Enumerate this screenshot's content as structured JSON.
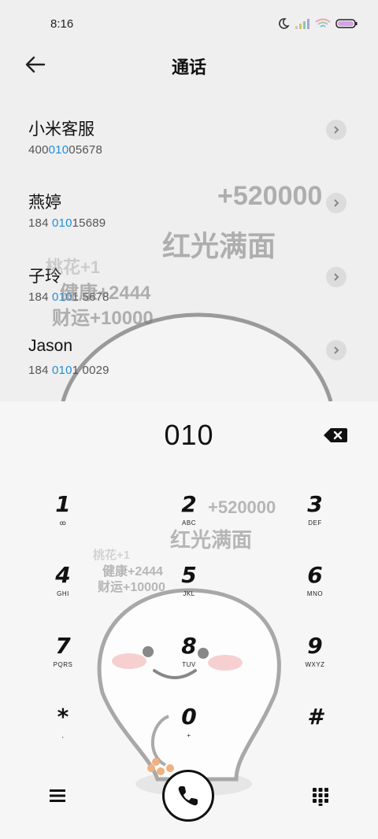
{
  "status": {
    "time": "8:16"
  },
  "header": {
    "title": "通话"
  },
  "contacts": [
    {
      "name": "小米客服",
      "num_pre": "400",
      "num_hl": "010",
      "num_post": "05678"
    },
    {
      "name": "燕婷",
      "num_pre": "184 ",
      "num_hl": "010",
      "num_post": "15689"
    },
    {
      "name": "子玲",
      "num_pre": "184 ",
      "num_hl": "010",
      "num_post": "1 5678"
    },
    {
      "name": "Jason",
      "num_pre": "184 ",
      "num_hl": "010",
      "num_post": "1 0029"
    }
  ],
  "watermark": {
    "big": "+520000",
    "face": "红光满面",
    "peach": "桃花+1",
    "health": "健康+2444",
    "wealth": "财运+10000"
  },
  "dialer": {
    "input": "010",
    "keys": [
      {
        "d": "1",
        "l": "ꝏ"
      },
      {
        "d": "2",
        "l": "ABC"
      },
      {
        "d": "3",
        "l": "DEF"
      },
      {
        "d": "4",
        "l": "GHI"
      },
      {
        "d": "5",
        "l": "JKL"
      },
      {
        "d": "6",
        "l": "MNO"
      },
      {
        "d": "7",
        "l": "PQRS"
      },
      {
        "d": "8",
        "l": "TUV"
      },
      {
        "d": "9",
        "l": "WXYZ"
      },
      {
        "d": "*",
        "l": ","
      },
      {
        "d": "0",
        "l": "+"
      },
      {
        "d": "#",
        "l": ""
      }
    ]
  },
  "icons": {
    "back": "arrow-left-icon",
    "delete": "backspace-icon",
    "menu": "hamburger-menu-icon",
    "call": "phone-icon",
    "keypad": "dialpad-icon"
  },
  "colors": {
    "highlight": "#1e8fd8",
    "background": "#efefef",
    "keypad_bg": "#f6f6f6"
  }
}
